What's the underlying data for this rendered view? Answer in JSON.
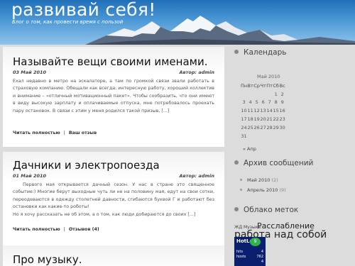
{
  "header": {
    "title": "развивай себя!",
    "description": "Блог о том, как провести время с пользой"
  },
  "posts": [
    {
      "title": "Называйте вещи своими именами.",
      "date": "03 Май 2010",
      "author": "Автор: admin",
      "body": "Ехал недавно в метро на эскалаторе, а там по громкой связи звали работать в страховую компанию. Обещали как всегда, интересную работу, хороший коллектив и внимание – «отличный мотивационный пакет». Чтобы сообразить, что они имеют в виду высокую зарплату и оплачиваемые отпуска, мне потребовалось проехать пару остановок. В связи с этим у меня родился такой призыв, [...]",
      "read_more": "Читать полностью",
      "comments": "Ваш отзыв"
    },
    {
      "title": "Дачники и электропоезда",
      "date": "01 Май 2010",
      "author": "Автор: admin",
      "body1": "Первого мая открывается дачный сезон. У нас в стране это священное событие:) Многие берут выходные чуть ли не на половину мая, едут на свои сотки, переодеваются в одежду столетней давности, сгибаются буквой Г и работают без остановки как какие-то роботы!",
      "body2": "Но я хочу рассказать не об этом, а о том, как люди добираются до своих [...]",
      "read_more": "Читать полностью",
      "comments": "Отзывов (4)"
    },
    {
      "title": "Про музыку."
    }
  ],
  "sidebar": {
    "calendar_title": "Календарь",
    "calendar": {
      "caption": "Май 2010",
      "weekdays": [
        "Пн",
        "Вт",
        "Ср",
        "Чт",
        "Пт",
        "Сб",
        "Вс"
      ],
      "rows": [
        [
          "",
          "",
          "",
          "",
          "",
          "1",
          "2"
        ],
        [
          "3",
          "4",
          "5",
          "6",
          "7",
          "8",
          "9"
        ],
        [
          "10",
          "11",
          "12",
          "13",
          "14",
          "15",
          "16"
        ],
        [
          "17",
          "18",
          "19",
          "20",
          "21",
          "22",
          "23"
        ],
        [
          "24",
          "25",
          "26",
          "27",
          "28",
          "29",
          "30"
        ],
        [
          "31",
          "",
          "",
          "",
          "",
          "",
          ""
        ]
      ],
      "prev": "« Апр"
    },
    "archive_title": "Архив сообщений",
    "archive": [
      {
        "label": "Май 2010",
        "count": "(2)"
      },
      {
        "label": "Апрель 2010",
        "count": "(9)"
      }
    ],
    "tags_title": "Облако меток",
    "tags": [
      "ЖД Музыка",
      "Расслабление",
      "работа над собой"
    ],
    "badge": {
      "logo": "HotLog",
      "ring": "9",
      "rows": [
        [
          "hits",
          "4"
        ],
        [
          "hosts",
          "762"
        ],
        [
          "",
          "4"
        ]
      ]
    }
  },
  "colors": {
    "header_top": "#1f6fb8",
    "page_bg": "#dcdcdc"
  }
}
